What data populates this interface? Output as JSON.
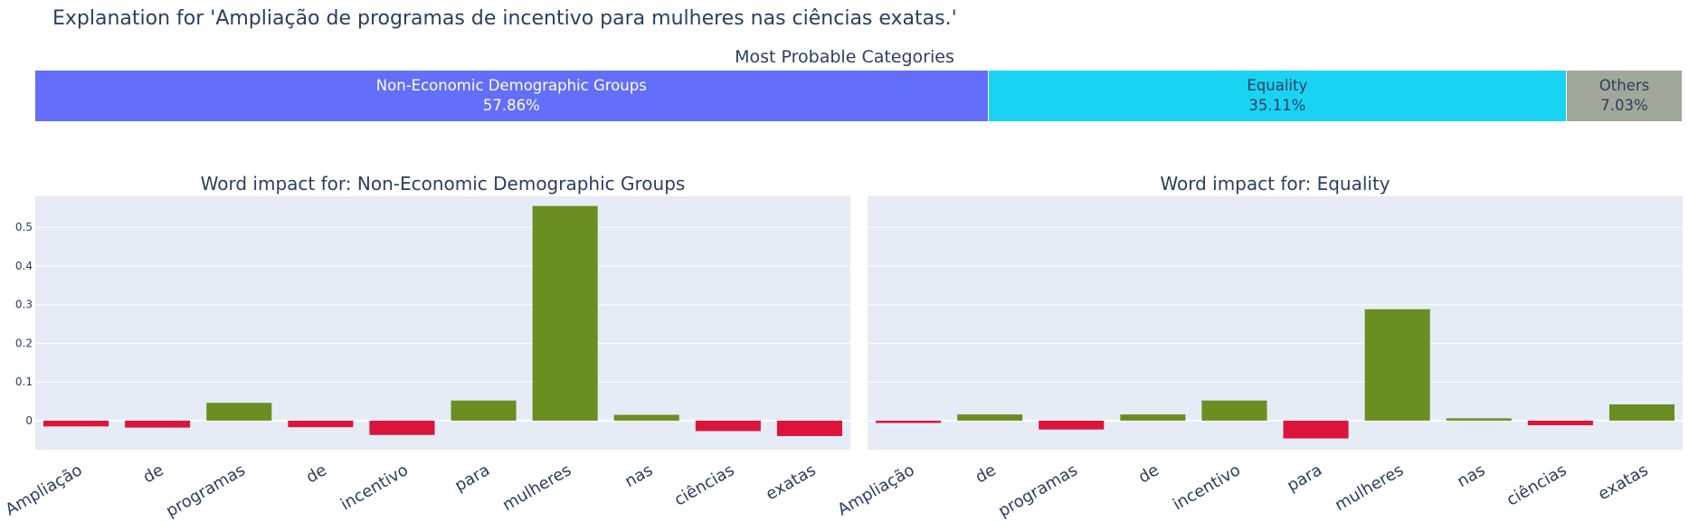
{
  "title": "Explanation for 'Ampliação de programas de incentivo para mulheres nas ciências exatas.'",
  "categories_panel": {
    "title": "Most Probable Categories",
    "segments": [
      {
        "label": "Non-Economic Demographic Groups",
        "percent": "57.86%",
        "share": 57.86,
        "color": "#636efa",
        "text_color": "#ffffff"
      },
      {
        "label": "Equality",
        "percent": "35.11%",
        "share": 35.11,
        "color": "#19d3f3",
        "text_color": "#2a3f5f"
      },
      {
        "label": "Others",
        "percent": "7.03%",
        "share": 7.03,
        "color": "#a1a799",
        "text_color": "#2a3f5f"
      }
    ]
  },
  "colors": {
    "positive": "#6b8e23",
    "negative": "#dc143c",
    "plot_bg": "#e5ecf6",
    "grid": "#ffffff",
    "text": "#2a3f5f"
  },
  "chart_data": [
    {
      "type": "bar",
      "title": "Word impact for: Non-Economic Demographic Groups",
      "categories": [
        "Ampliação",
        "de",
        "programas",
        "de",
        "incentivo",
        "para",
        "mulheres",
        "nas",
        "ciências",
        "exatas"
      ],
      "values": [
        -0.015,
        -0.018,
        0.046,
        -0.017,
        -0.037,
        0.052,
        0.555,
        0.015,
        -0.027,
        -0.04
      ],
      "ylim": [
        -0.075,
        0.58
      ],
      "yticks": [
        0,
        0.1,
        0.2,
        0.3,
        0.4,
        0.5
      ],
      "ytick_labels": [
        "0",
        "0.1",
        "0.2",
        "0.3",
        "0.4",
        "0.5"
      ],
      "grid": true
    },
    {
      "type": "bar",
      "title": "Word impact for: Equality",
      "categories": [
        "Ampliação",
        "de",
        "programas",
        "de",
        "incentivo",
        "para",
        "mulheres",
        "nas",
        "ciências",
        "exatas"
      ],
      "values": [
        -0.006,
        0.016,
        -0.023,
        0.016,
        0.052,
        -0.046,
        0.288,
        0.006,
        -0.012,
        0.042
      ],
      "ylim": [
        -0.075,
        0.58
      ],
      "yticks": [
        0,
        0.1,
        0.2,
        0.3,
        0.4,
        0.5
      ],
      "grid": true
    }
  ]
}
